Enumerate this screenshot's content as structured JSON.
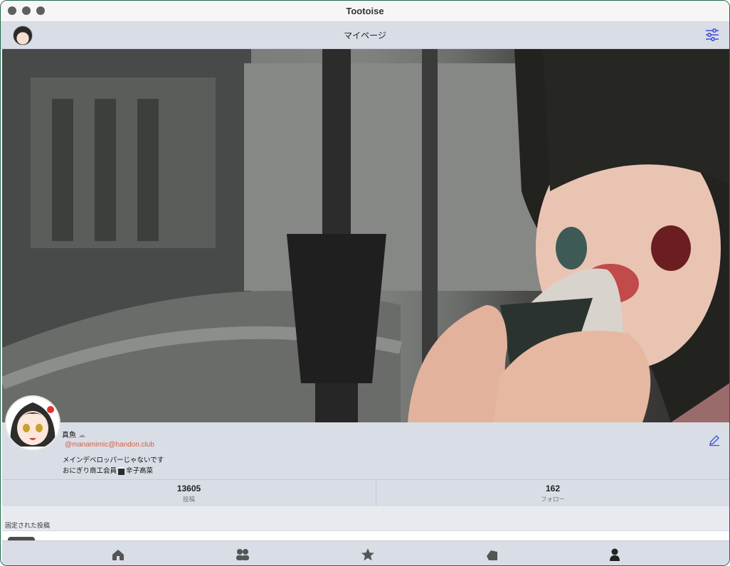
{
  "window": {
    "title": "Tootoise"
  },
  "nav": {
    "title": "マイページ"
  },
  "profile": {
    "display_name": "真魚",
    "handle": "@manamimic@handon.club",
    "bio_line1": "メインデベロッパーじゃないです",
    "bio_line2_prefix": "おにぎり商工会員",
    "bio_line2_suffix": "辛子高菜"
  },
  "stats": [
    {
      "value": "13605",
      "label": "投稿"
    },
    {
      "value": "162",
      "label": "フォロー"
    }
  ],
  "pinned": {
    "label": "固定された投稿"
  },
  "tabs": [
    "home-icon",
    "people-icon",
    "star-icon",
    "megaphone-icon",
    "person-icon"
  ],
  "colors": {
    "accent": "#3b4fd8",
    "handle": "#e05a3a",
    "bar": "#d9dde6"
  }
}
